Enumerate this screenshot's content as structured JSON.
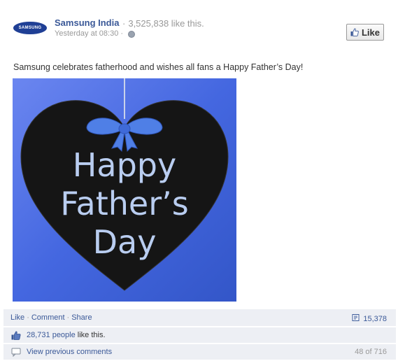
{
  "post": {
    "page_name": "Samsung India",
    "page_like_separator": "·",
    "page_likes": "3,525,838 like this.",
    "timestamp": "Yesterday at 08:30 ·",
    "logo_text": "SAMSUNG",
    "like_button_label": "Like",
    "message": "Samsung celebrates fatherhood and wishes all fans a Happy Father’s Day!",
    "photo": {
      "line1": "Happy",
      "line2": "Father’s",
      "line3": "Day"
    }
  },
  "actions": {
    "like": "Like",
    "comment": "Comment",
    "share": "Share",
    "separator": "·",
    "share_count": "15,378"
  },
  "likes": {
    "count_link": "28,731 people",
    "suffix": " like this."
  },
  "comments": {
    "view_previous": "View previous comments",
    "count": "48 of 716"
  },
  "colors": {
    "link": "#3b5998",
    "bar_bg": "#edeff4",
    "photo_bg": "#4a6fe0",
    "heart": "#151515",
    "ribbon": "#4f7fe6"
  },
  "icons": {
    "logo": "samsung-logo",
    "thumb": "thumbs-up-icon",
    "globe": "globe-icon",
    "share": "share-icon",
    "comment": "comment-icon"
  }
}
